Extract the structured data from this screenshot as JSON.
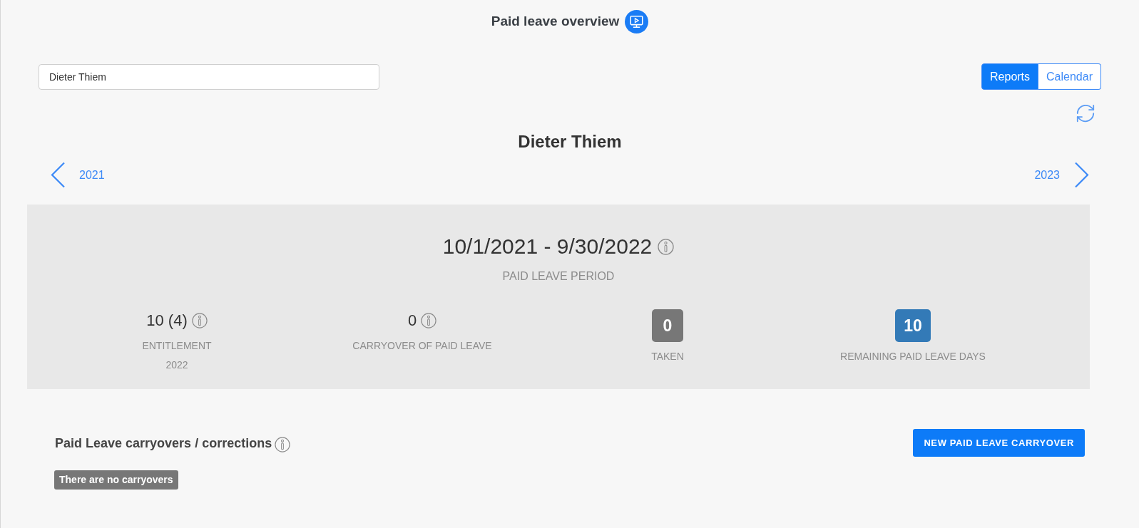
{
  "header": {
    "title": "Paid leave overview"
  },
  "search": {
    "value": "Dieter Thiem"
  },
  "view_tabs": [
    {
      "label": "Reports",
      "selected": true
    },
    {
      "label": "Calendar",
      "selected": false
    }
  ],
  "employee": {
    "name": "Dieter Thiem"
  },
  "year_nav": {
    "previous": "2021",
    "next": "2023"
  },
  "period": {
    "range": "10/1/2021 - 9/30/2022",
    "label": "PAID LEAVE PERIOD"
  },
  "stats": [
    {
      "kind": "plain",
      "value": "10 (4)",
      "label": "ENTITLEMENT",
      "sublabel": "2022",
      "info": true
    },
    {
      "kind": "plain",
      "value": "0",
      "label": "CARRYOVER OF PAID LEAVE",
      "info": true
    },
    {
      "kind": "badge",
      "value": "0",
      "label": "TAKEN",
      "color": "#777777"
    },
    {
      "kind": "badge",
      "value": "10",
      "label": "REMAINING PAID LEAVE DAYS",
      "color": "#337ab7"
    }
  ],
  "carryovers": {
    "title": "Paid Leave carryovers / corrections",
    "button": "NEW PAID LEAVE CARRYOVER",
    "empty_message": "There are no carryovers"
  }
}
